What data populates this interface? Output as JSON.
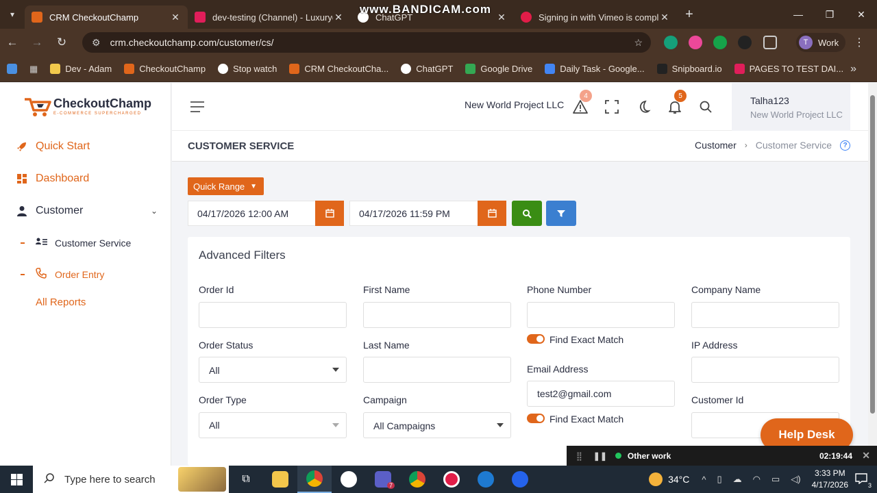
{
  "browser": {
    "tabs": [
      {
        "label": "CRM CheckoutChamp",
        "active": true,
        "color": "#e0661b"
      },
      {
        "label": "dev-testing (Channel) - Luxuryc",
        "active": false,
        "color": "#e01e5a"
      },
      {
        "label": "ChatGPT",
        "active": false,
        "color": "#ffffff"
      },
      {
        "label": "Signing in with Vimeo is compl",
        "active": false,
        "color": "#e11d48"
      }
    ],
    "watermark": "www.BANDICAM.com",
    "url": "crm.checkoutchamp.com/customer/cs/",
    "profile_initial": "T",
    "profile_label": "Work",
    "bookmarks": [
      {
        "label": "Dev - Adam",
        "color": "#f2c94c"
      },
      {
        "label": "CheckoutChamp",
        "color": "#e0661b"
      },
      {
        "label": "Stop watch",
        "color": "#ffffff"
      },
      {
        "label": "CRM CheckoutCha...",
        "color": "#e0661b"
      },
      {
        "label": "ChatGPT",
        "color": "#ffffff"
      },
      {
        "label": "Google Drive",
        "color": "#34a853"
      },
      {
        "label": "Daily Task - Google...",
        "color": "#4285f4"
      },
      {
        "label": "Snipboard.io",
        "color": "#222222"
      },
      {
        "label": "PAGES TO TEST DAI...",
        "color": "#e01e5a"
      }
    ]
  },
  "app": {
    "brand": "CheckoutChamp",
    "tagline": "E-COMMERCE SUPERCHARGED",
    "accent": "#e0661b",
    "sidebar": {
      "quick_start": "Quick Start",
      "dashboard": "Dashboard",
      "customer": "Customer",
      "customer_service": "Customer Service",
      "order_entry": "Order Entry",
      "all_reports": "All Reports"
    },
    "topbar": {
      "company": "New World Project LLC",
      "alert_count": "4",
      "notification_count": "5",
      "user_name": "Talha123",
      "user_company": "New World Project LLC"
    },
    "page": {
      "title": "CUSTOMER SERVICE",
      "breadcrumb_parent": "Customer",
      "breadcrumb_current": "Customer Service"
    },
    "range": {
      "quick_range_label": "Quick Range",
      "start": "04/17/2026 12:00 AM",
      "end": "04/17/2026 11:59 PM"
    },
    "filters": {
      "title": "Advanced Filters",
      "order_id_label": "Order Id",
      "order_id_value": "",
      "first_name_label": "First Name",
      "first_name_value": "",
      "phone_label": "Phone Number",
      "phone_value": "",
      "company_label": "Company Name",
      "company_value": "",
      "order_status_label": "Order Status",
      "order_status_value": "All",
      "last_name_label": "Last Name",
      "last_name_value": "",
      "find_exact_1": "Find Exact Match",
      "ip_label": "IP Address",
      "ip_value": "",
      "email_label": "Email Address",
      "email_value": "test2@gmail.com",
      "order_type_label": "Order Type",
      "order_type_value": "All",
      "campaign_label": "Campaign",
      "campaign_value": "All Campaigns",
      "find_exact_2": "Find Exact Match",
      "customer_id_label": "Customer Id",
      "customer_id_value": ""
    },
    "help_desk": "Help Desk"
  },
  "recorder": {
    "label": "Other work",
    "time": "02:19:44"
  },
  "taskbar": {
    "search_placeholder": "Type here to search",
    "temperature": "34°C",
    "time": "3:33 PM",
    "date": "4/17/2026",
    "teams_badge": "7",
    "notif_count": "3"
  }
}
